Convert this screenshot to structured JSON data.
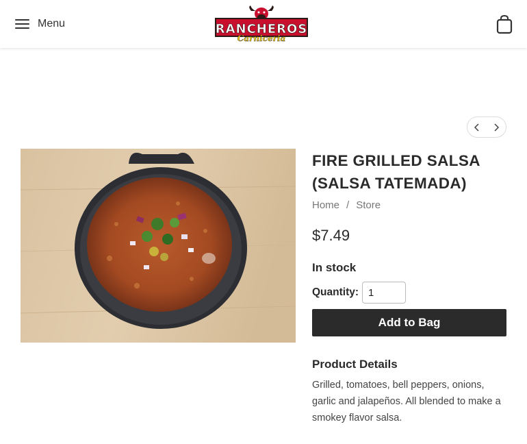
{
  "header": {
    "menu_label": "Menu",
    "logo_text": "RANCHEROS",
    "logo_subtext": "Carniceria",
    "brand_colors": {
      "red": "#c8102e",
      "dark": "#2a1a18",
      "yellow": "#f2d21a"
    }
  },
  "gallery": {
    "prev_icon": "chevron-left-icon",
    "next_icon": "chevron-right-icon"
  },
  "product": {
    "title": "FIRE GRILLED SALSA (SALSA TATEMADA)",
    "breadcrumb": [
      "Home",
      "Store"
    ],
    "breadcrumb_separator": "/",
    "price": "$7.49",
    "stock_status": "In stock",
    "quantity_label": "Quantity:",
    "quantity_value": "1",
    "add_button_label": "Add to Bag",
    "details_heading": "Product Details",
    "details_text": "Grilled, tomatoes, bell peppers, onions, garlic and jalapeños. All blended to make a smokey flavor salsa."
  }
}
